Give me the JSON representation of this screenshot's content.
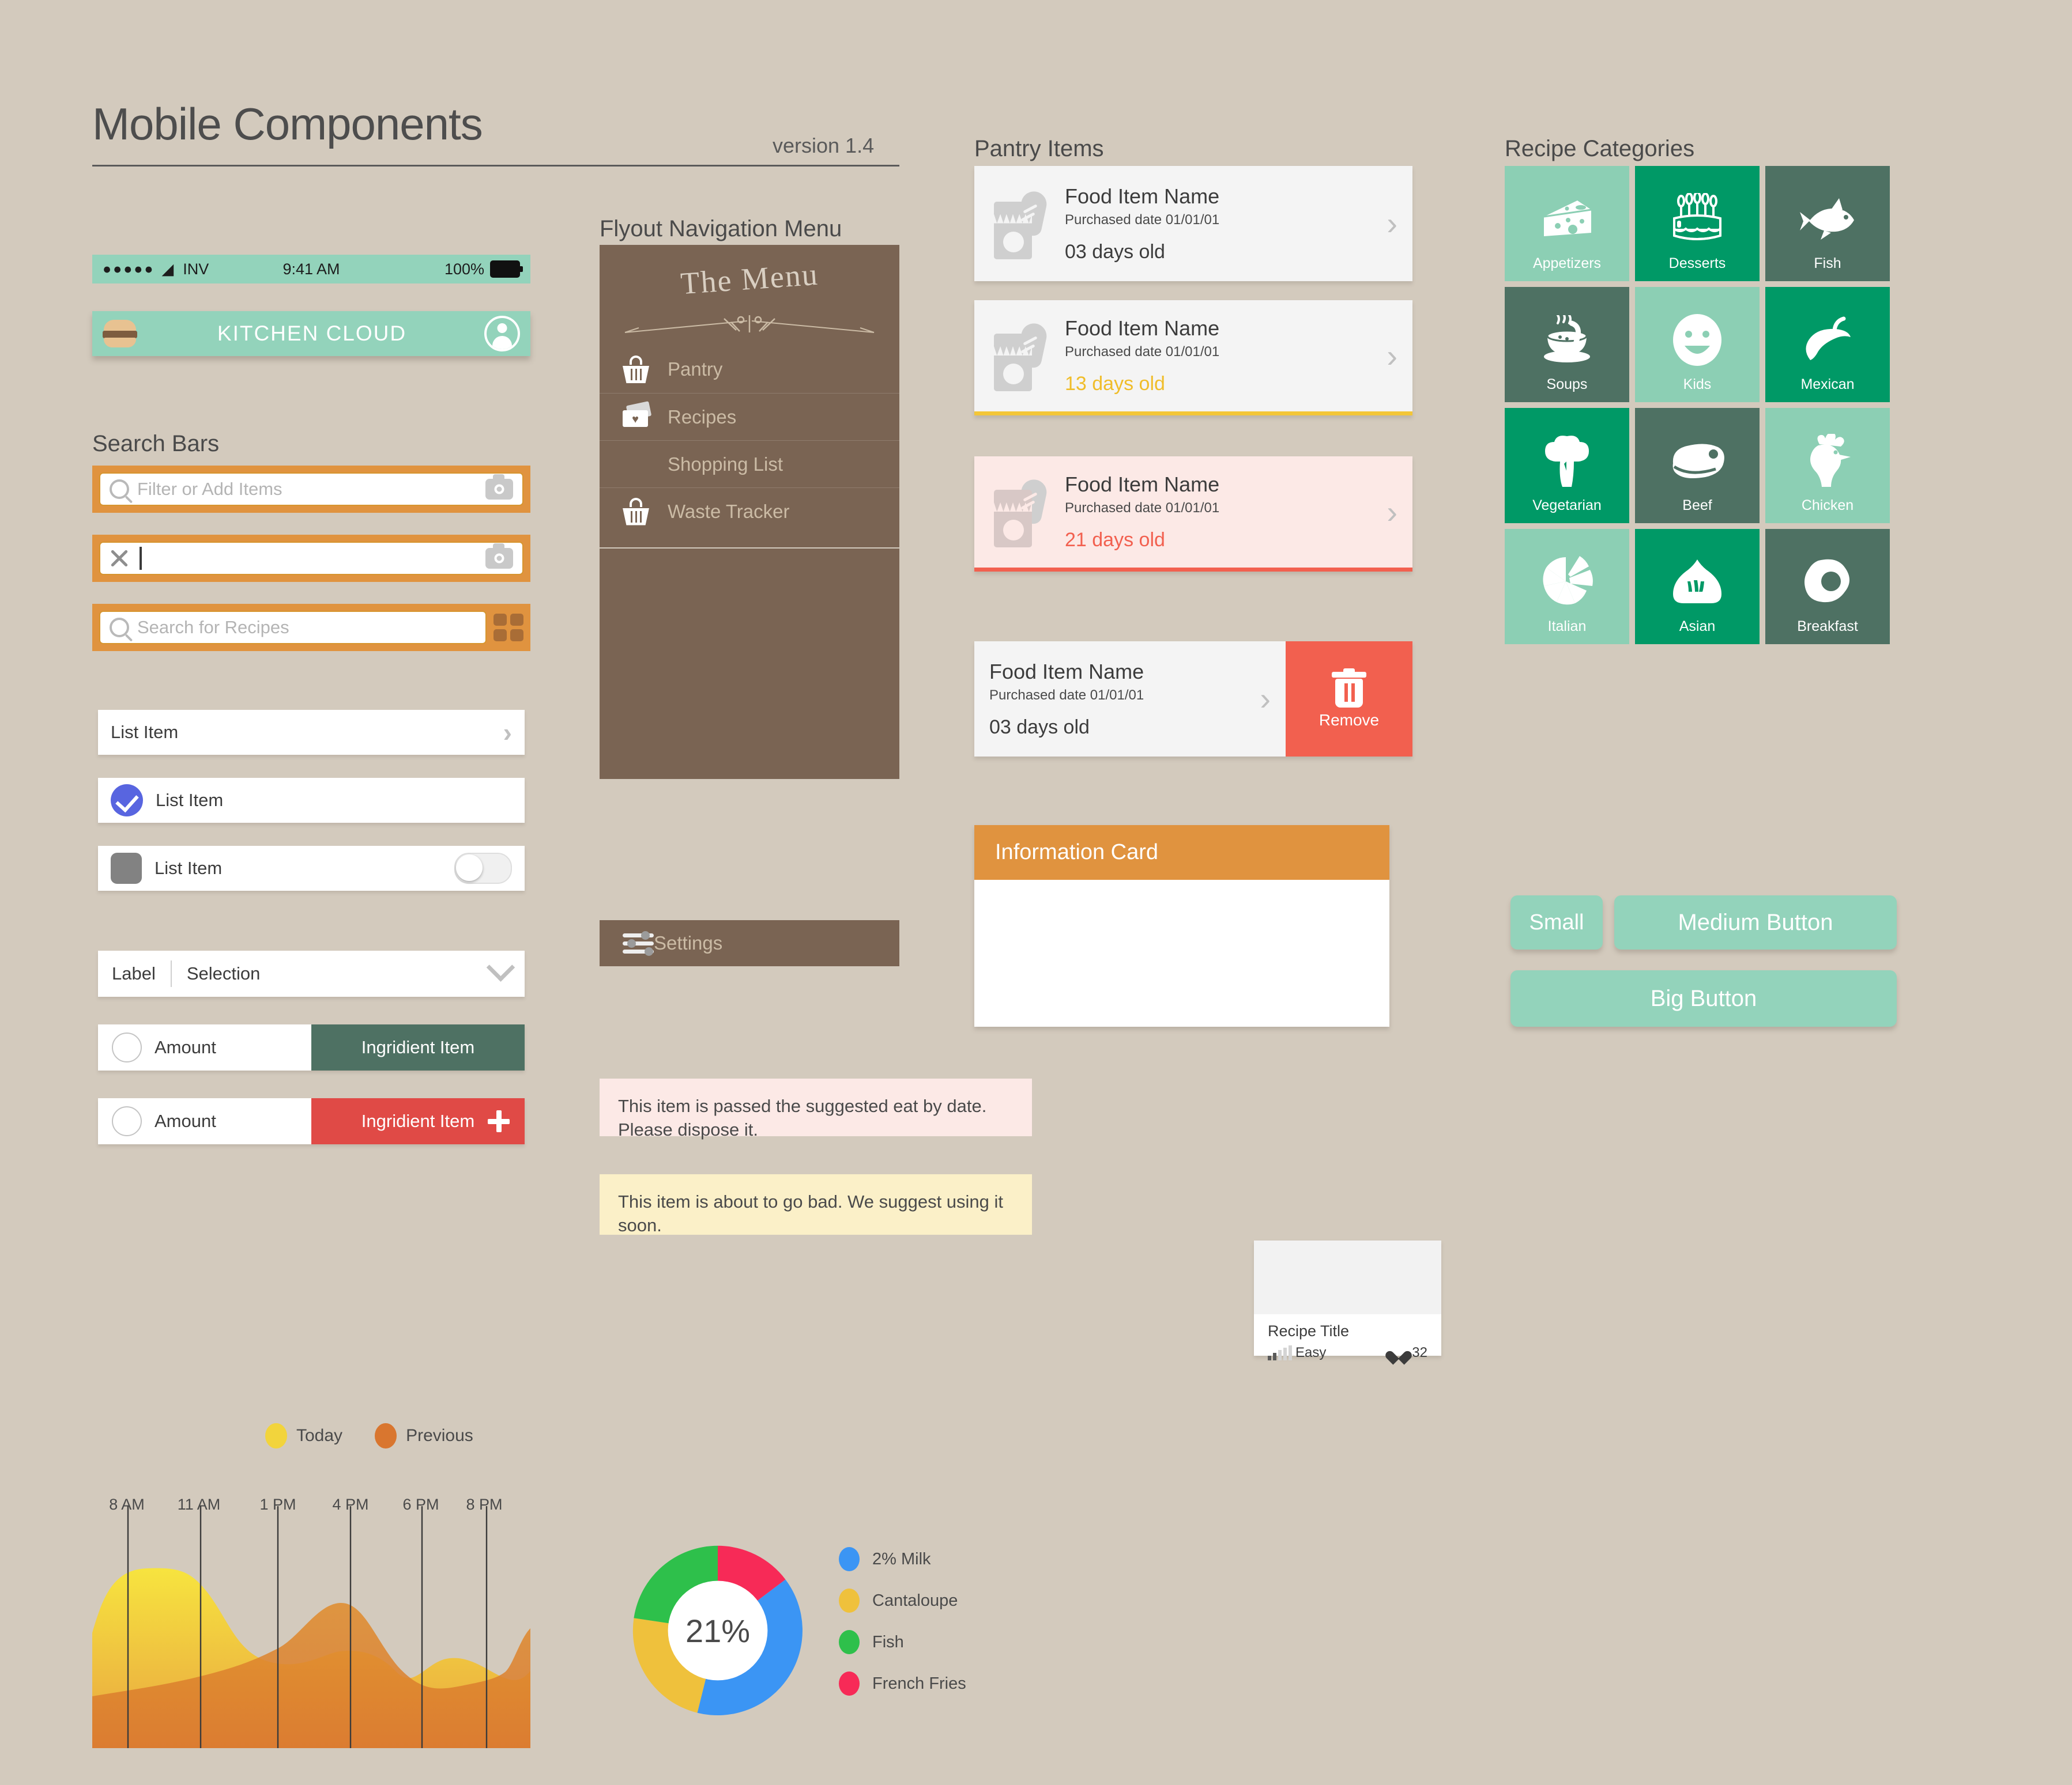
{
  "header": {
    "title": "Mobile Components",
    "version": "version 1.4"
  },
  "status_bar": {
    "signal_dots": "●●●●●",
    "wifi_icon": "wifi-icon",
    "carrier": "INV",
    "time": "9:41 AM",
    "battery_percent": "100%"
  },
  "app_bar": {
    "brand": "KITCHEN CLOUD",
    "logo_icon": "burger-icon",
    "account_icon": "user-avatar-icon"
  },
  "search_section": {
    "title": "Search Bars",
    "bar1": {
      "placeholder": "Filter or Add Items",
      "search_icon": "search-icon",
      "camera_icon": "camera-icon"
    },
    "bar2": {
      "value": "",
      "clear_icon": "clear-x-icon",
      "camera_icon": "camera-icon"
    },
    "bar3": {
      "placeholder": "Search for Recipes",
      "search_icon": "search-icon",
      "grid_icon": "grid-view-icon"
    }
  },
  "list_items": {
    "row1": {
      "label": "List Item",
      "chevron": "›"
    },
    "row2": {
      "label": "List Item",
      "check_icon": "check-circle-icon"
    },
    "row3": {
      "label": "List Item",
      "thumb_icon": "square-thumb-icon",
      "toggle_state": "off"
    },
    "select": {
      "label": "Label",
      "value": "Selection",
      "caret_icon": "chevron-down-icon"
    },
    "ingredient1": {
      "amount": "Amount",
      "name": "Ingridient Item"
    },
    "ingredient2": {
      "amount": "Amount",
      "name": "Ingridient Item",
      "add_icon": "plus-icon"
    }
  },
  "flyout": {
    "title": "Flyout Navigation Menu",
    "menu_heading": "The Menu",
    "items": [
      {
        "label": "Pantry",
        "icon": "basket-icon"
      },
      {
        "label": "Recipes",
        "icon": "recipe-card-icon"
      },
      {
        "label": "Shopping List",
        "icon": "receipt-icon"
      },
      {
        "label": "Waste Tracker",
        "icon": "basket-icon"
      }
    ],
    "settings": {
      "label": "Settings",
      "icon": "sliders-icon"
    }
  },
  "pantry": {
    "title": "Pantry Items",
    "items": [
      {
        "name": "Food Item Name",
        "purchased": "Purchased date 01/01/01",
        "age": "03 days old",
        "state": "fresh"
      },
      {
        "name": "Food Item Name",
        "purchased": "Purchased date 01/01/01",
        "age": "13 days old",
        "state": "warning"
      },
      {
        "name": "Food Item Name",
        "purchased": "Purchased date 01/01/01",
        "age": "21 days old",
        "state": "expired"
      },
      {
        "name": "Food Item Name",
        "purchased": "Purchased date 01/01/01",
        "age": "03 days old",
        "state": "swipe"
      }
    ],
    "remove_label": "Remove",
    "remove_icon": "trash-icon"
  },
  "info_card": {
    "title": "Information Card"
  },
  "alerts": {
    "expired": "This item is passed the suggested eat by date. Please dispose it.",
    "warning": "This item is about to go bad. We suggest using it soon."
  },
  "recipe_card": {
    "title": "Recipe Title",
    "difficulty": "Easy",
    "likes": "32",
    "heart_icon": "heart-icon",
    "difficulty_icon": "signal-bars-icon"
  },
  "categories": {
    "title": "Recipe Categories",
    "tiles": [
      {
        "label": "Appetizers",
        "icon": "cheese-icon",
        "color": "#8ccfb4"
      },
      {
        "label": "Desserts",
        "icon": "cake-icon",
        "color": "#009966"
      },
      {
        "label": "Fish",
        "icon": "fish-icon",
        "color": "#4e7163"
      },
      {
        "label": "Soups",
        "icon": "soup-bowl-icon",
        "color": "#4e7163"
      },
      {
        "label": "Kids",
        "icon": "smiley-face-icon",
        "color": "#8ccfb4"
      },
      {
        "label": "Mexican",
        "icon": "chili-pepper-icon",
        "color": "#009966"
      },
      {
        "label": "Vegetarian",
        "icon": "broccoli-icon",
        "color": "#009966"
      },
      {
        "label": "Beef",
        "icon": "steak-icon",
        "color": "#4e7163"
      },
      {
        "label": "Chicken",
        "icon": "rooster-icon",
        "color": "#8ccfb4"
      },
      {
        "label": "Italian",
        "icon": "pizza-icon",
        "color": "#8ccfb4"
      },
      {
        "label": "Asian",
        "icon": "dumpling-icon",
        "color": "#009966"
      },
      {
        "label": "Breakfast",
        "icon": "fried-egg-icon",
        "color": "#4e7163"
      }
    ]
  },
  "buttons": {
    "small": "Small",
    "medium": "Medium Button",
    "big": "Big Button"
  },
  "colors": {
    "background": "#d3cabd",
    "mint": "#93d3bb",
    "orange": "#e0933f",
    "brown": "#7a6453",
    "red": "#f2604f",
    "yellow": "#f0bd2a"
  },
  "chart_data": [
    {
      "type": "area",
      "title": "",
      "xlabel": "",
      "ylabel": "",
      "grid": true,
      "legend_position": "top",
      "categories": [
        "8 AM",
        "11 AM",
        "1 PM",
        "4 PM",
        "6 PM",
        "8 PM"
      ],
      "tick_positions_pct": [
        13,
        38,
        68,
        100,
        130,
        163
      ],
      "series": [
        {
          "name": "Today",
          "color": "#f2d43c",
          "values": [
            62,
            78,
            80,
            42,
            22,
            30,
            18,
            26,
            14
          ]
        },
        {
          "name": "Previous",
          "color": "#d9762f",
          "values": [
            20,
            24,
            30,
            38,
            52,
            74,
            40,
            26,
            22,
            46
          ]
        }
      ]
    },
    {
      "type": "pie",
      "title": "",
      "center_label": "21%",
      "labels": [
        "2% Milk",
        "Cantaloupe",
        "Fish",
        "French Fries"
      ],
      "values": [
        30,
        20,
        25,
        25
      ],
      "colors": [
        "#3b95f4",
        "#efc13c",
        "#2ec04b",
        "#f72a57"
      ],
      "legend_position": "right"
    }
  ]
}
